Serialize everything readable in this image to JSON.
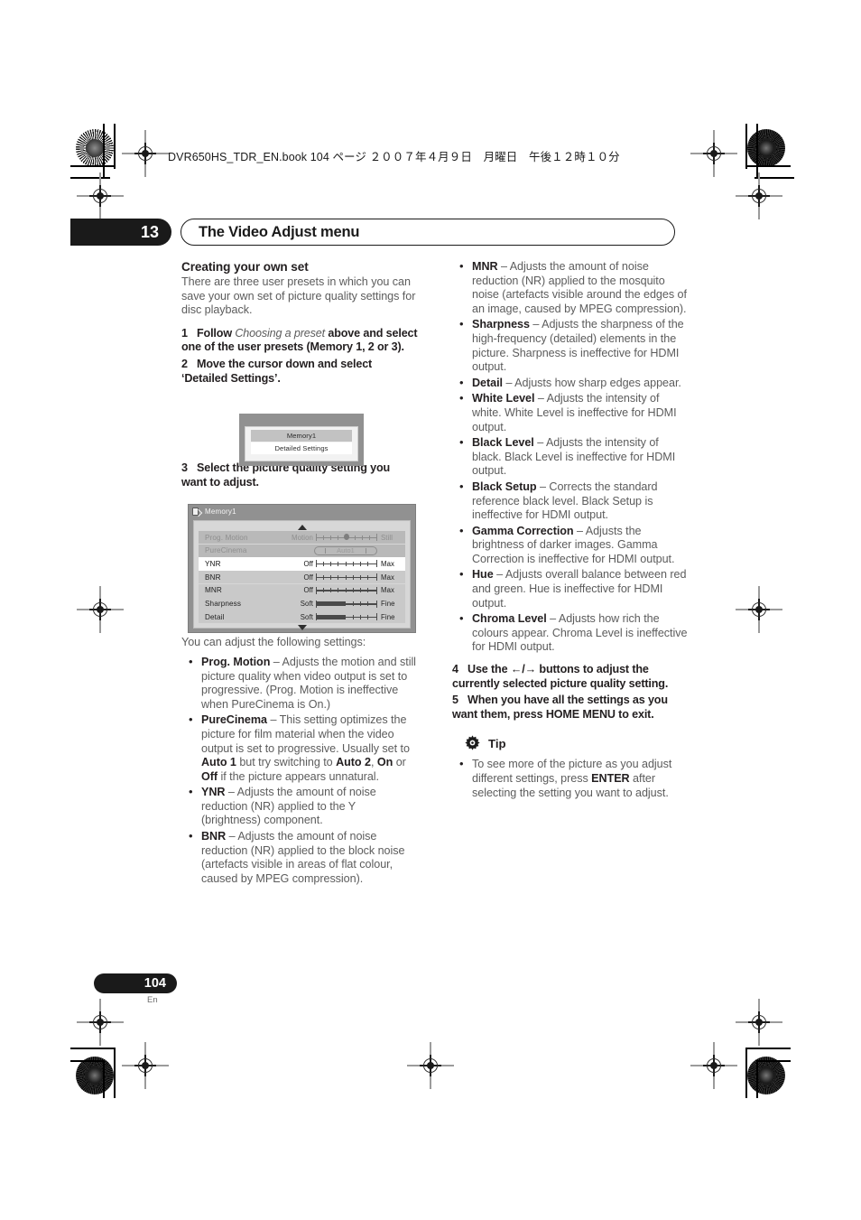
{
  "print_header": {
    "book_line": "DVR650HS_TDR_EN.book  104 ページ  ２００７年４月９日　月曜日　午後１２時１０分"
  },
  "chapter": {
    "number": "13",
    "title": "The Video Adjust menu"
  },
  "left_column": {
    "heading": "Creating your own set",
    "intro": "There are three user presets in which you can save your own set of picture quality settings for disc playback.",
    "step1_num": "1",
    "step1_a": "Follow ",
    "step1_italic": "Choosing a preset",
    "step1_b": " above and select one of the user presets (Memory 1, 2 or 3).",
    "step2_num": "2",
    "step2": "Move the cursor down and select ‘Detailed Settings’.",
    "step3_num": "3",
    "step3": "Select the picture quality setting you want to adjust.",
    "after_fig": "You can adjust the following settings:",
    "bullets": [
      {
        "term": "Prog. Motion",
        "dash": " – ",
        "text": "Adjusts the motion and still picture quality when video output is set to progressive. (Prog. Motion is ineffective when PureCinema is On.)"
      },
      {
        "term": "PureCinema",
        "dash": " – ",
        "text": "This setting optimizes the picture for film material when the video output is set to progressive. Usually set to ",
        "bold_a": "Auto 1",
        "mid_a": " but try switching to ",
        "bold_b": "Auto 2",
        "mid_b": ", ",
        "bold_c": "On",
        "mid_c": " or ",
        "bold_d": "Off",
        "tail": " if the picture appears unnatural."
      },
      {
        "term": "YNR",
        "dash": " – ",
        "text": "Adjusts the amount of noise reduction (NR) applied to the Y (brightness) component."
      },
      {
        "term": "BNR",
        "dash": " – ",
        "text": "Adjusts the amount of noise reduction (NR) applied to the block noise (artefacts visible in areas of flat colour, caused by MPEG compression)."
      }
    ]
  },
  "right_column": {
    "bullets": [
      {
        "term": "MNR",
        "dash": " – ",
        "text": "Adjusts the amount of noise reduction (NR) applied to the mosquito noise (artefacts visible around the edges of an image, caused by MPEG compression)."
      },
      {
        "term": "Sharpness",
        "dash": " – ",
        "text": "Adjusts the sharpness of the high-frequency (detailed) elements in the picture. Sharpness is ineffective for HDMI output."
      },
      {
        "term": "Detail",
        "dash": " – ",
        "text": "Adjusts how sharp edges appear."
      },
      {
        "term": "White Level",
        "dash": " – ",
        "text": "Adjusts the intensity of white. White Level is ineffective for HDMI output."
      },
      {
        "term": "Black Level",
        "dash": " – ",
        "text": "Adjusts the intensity of black. Black Level is ineffective for HDMI output."
      },
      {
        "term": "Black Setup",
        "dash": " – ",
        "text": "Corrects the standard reference black level. Black Setup is ineffective for HDMI output."
      },
      {
        "term": "Gamma Correction",
        "dash": " – ",
        "text": "Adjusts the brightness of darker images. Gamma Correction is ineffective for HDMI output."
      },
      {
        "term": "Hue",
        "dash": " – ",
        "text": "Adjusts overall balance between red and green. Hue is ineffective for HDMI output."
      },
      {
        "term": "Chroma Level",
        "dash": " – ",
        "text": "Adjusts how rich the colours appear. Chroma Level is ineffective for HDMI output."
      }
    ],
    "step4_num": "4",
    "step4_a": "Use the ",
    "step4_arrows": "←/→",
    "step4_b": " buttons to adjust the currently selected picture quality setting.",
    "step5_num": "5",
    "step5": "When you have all the settings as you want them, press HOME MENU to exit.",
    "tip_title": "Tip",
    "tip_icon": "gear-icon",
    "tip_bullet_a": "To see more of the picture as you adjust different settings, press ",
    "tip_bullet_bold": "ENTER",
    "tip_bullet_b": " after selecting the setting you want to adjust."
  },
  "figure_preset": {
    "selected_row": "Memory1",
    "unselected_row": "Detailed Settings"
  },
  "figure_settings": {
    "title": "Memory1",
    "disc_icon": "disc-icon",
    "scroll_up_icon": "triangle-up-icon",
    "scroll_down_icon": "triangle-down-icon",
    "rows": [
      {
        "label": "Prog. Motion",
        "low": "Motion",
        "high": "Still",
        "state": "dim",
        "control": "slider",
        "knob_pct": 50,
        "ticks": 9
      },
      {
        "label": "PureCinema",
        "low": "",
        "high": "",
        "state": "dim",
        "control": "pill",
        "value": "Auto1"
      },
      {
        "label": "YNR",
        "low": "Off",
        "high": "Max",
        "state": "highlighted",
        "control": "slider",
        "knob_pct": -1,
        "ticks": 9
      },
      {
        "label": "BNR",
        "low": "Off",
        "high": "Max",
        "state": "normal",
        "control": "slider",
        "knob_pct": -1,
        "ticks": 9
      },
      {
        "label": "MNR",
        "low": "Off",
        "high": "Max",
        "state": "normal",
        "control": "slider",
        "knob_pct": -1,
        "ticks": 9
      },
      {
        "label": "Sharpness",
        "low": "Soft",
        "high": "Fine",
        "state": "normal",
        "control": "slider-fill",
        "fill_pct": 48,
        "ticks": 9
      },
      {
        "label": "Detail",
        "low": "Soft",
        "high": "Fine",
        "state": "normal",
        "control": "slider-fill",
        "fill_pct": 48,
        "ticks": 9
      }
    ]
  },
  "footer": {
    "page_number": "104",
    "language": "En"
  },
  "colors": {
    "ink": "#231f20",
    "body_grey": "#5c5c5c",
    "chapter_bar": "#1a1a1a",
    "panel_frame": "#919191",
    "panel_body": "#d7d7d7",
    "row_highlight": "#ffffff"
  }
}
